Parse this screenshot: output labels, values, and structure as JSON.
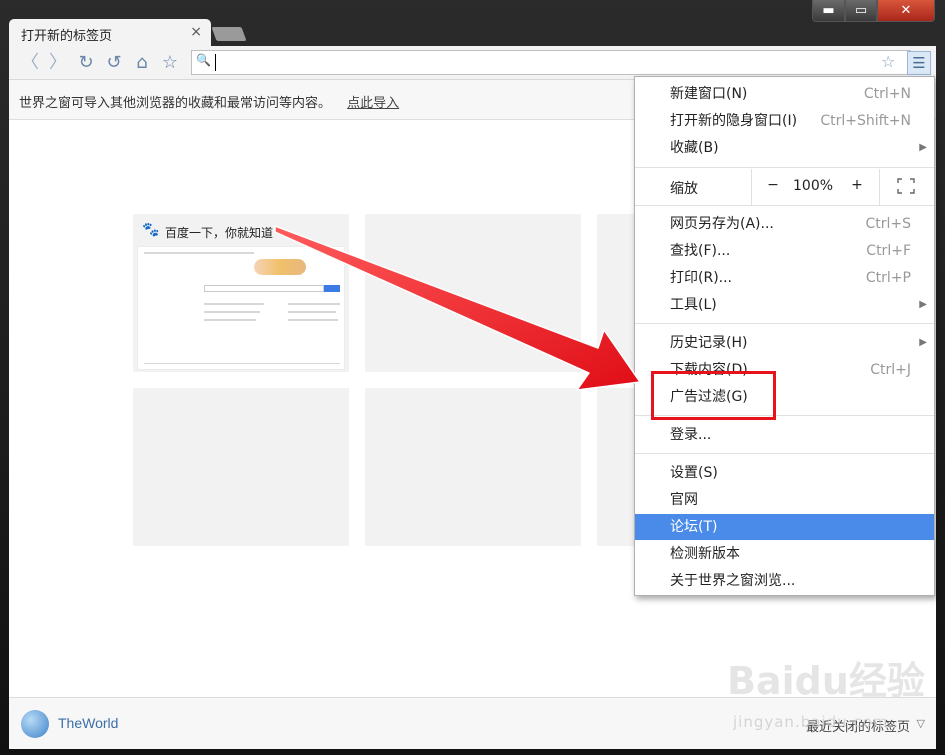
{
  "window": {
    "min_glyph": "▬",
    "max_glyph": "▭",
    "close_glyph": "✕"
  },
  "tab": {
    "title": "打开新的标签页",
    "close_glyph": "×"
  },
  "toolbar": {
    "icons": [
      "back-icon",
      "forward-icon",
      "reload-icon",
      "undo-icon",
      "home-icon",
      "star-icon"
    ],
    "back_glyph": "〈",
    "forward_glyph": "〉",
    "reload_glyph": "↻",
    "undo_glyph": "↺",
    "home_glyph": "⌂",
    "star_glyph": "☆",
    "search_glyph": "🔍",
    "omnibox_value": "",
    "menu_glyph": "☰"
  },
  "infobar": {
    "message": "世界之窗可导入其他浏览器的收藏和最常访问等内容。",
    "link": "点此导入"
  },
  "tiles": {
    "first_title": "百度一下，你就知道",
    "paw_glyph": "🐾"
  },
  "bottombar": {
    "brand": "TheWorld",
    "recent_closed": "最近关闭的标签页",
    "arrow": "▽"
  },
  "menu": {
    "items": [
      {
        "label": "新建窗口(N)",
        "shortcut": "Ctrl+N"
      },
      {
        "label": "打开新的隐身窗口(I)",
        "shortcut": "Ctrl+Shift+N"
      },
      {
        "label": "收藏(B)",
        "shortcut": ""
      },
      {
        "label": "网页另存为(A)...",
        "shortcut": "Ctrl+S"
      },
      {
        "label": "查找(F)...",
        "shortcut": "Ctrl+F"
      },
      {
        "label": "打印(R)...",
        "shortcut": "Ctrl+P"
      },
      {
        "label": "工具(L)",
        "shortcut": ""
      },
      {
        "label": "历史记录(H)",
        "shortcut": ""
      },
      {
        "label": "下载内容(D)",
        "shortcut": "Ctrl+J"
      },
      {
        "label": "广告过滤(G)",
        "shortcut": ""
      },
      {
        "label": "登录...",
        "shortcut": ""
      },
      {
        "label": "设置(S)",
        "shortcut": ""
      },
      {
        "label": "官网",
        "shortcut": ""
      },
      {
        "label": "论坛(T)",
        "shortcut": ""
      },
      {
        "label": "检测新版本",
        "shortcut": ""
      },
      {
        "label": "关于世界之窗浏览...",
        "shortcut": ""
      }
    ],
    "submenu_arrow": "▶",
    "zoom": {
      "label": "缩放",
      "minus": "−",
      "value": "100%",
      "plus": "+"
    },
    "highlighted_item": "论坛(T)"
  },
  "annotation": {
    "color": "#e8121c"
  },
  "watermark": {
    "text": "Baidu经验",
    "sub": "jingyan.baidu.com"
  },
  "colors": {
    "menu_highlight": "#4a8ae8",
    "link_blue": "#3a6ea8"
  }
}
